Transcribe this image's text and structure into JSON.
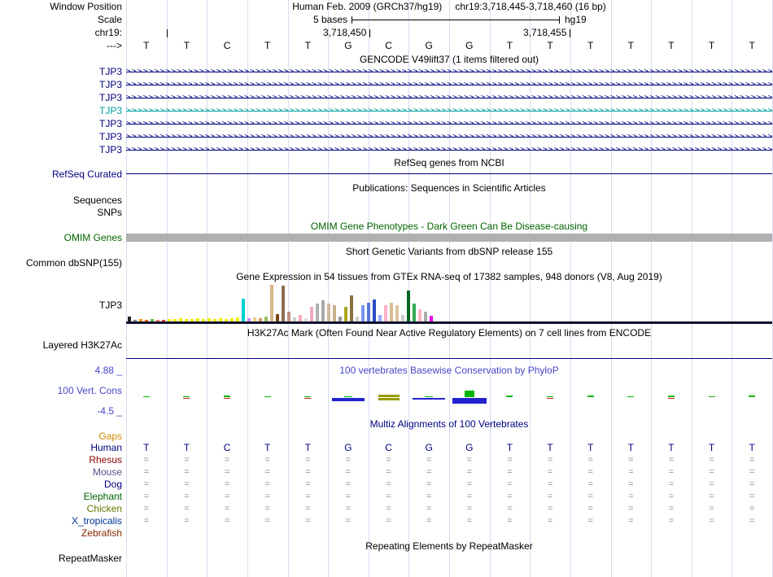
{
  "colors": {
    "gridline": "#d8ddf1",
    "navy": "#000080",
    "teal_gene": "#009e9e",
    "dark_green": "#006400",
    "phylop_blue": "#4646c8",
    "gaps_orange": "#cc8800",
    "omim_bar_gray": "#b0b0b0",
    "cons_green": "#00b400",
    "cons_blue": "#2323cd",
    "cons_red": "#c82323",
    "cons_olive": "#9a9a00"
  },
  "header": {
    "window_position_label": "Window Position",
    "assembly_line": "Human Feb. 2009 (GRCh37/hg19)",
    "range_line": "chr19:3,718,445-3,718,460 (16 bp)",
    "scale_label": "Scale",
    "scale_value": "5 bases",
    "assembly_short": "hg19",
    "chrom_label": "chr19:",
    "tick_label_1": "3,718,450",
    "tick_label_2": "3,718,455",
    "strand_label": "--->",
    "bases": [
      "T",
      "T",
      "C",
      "T",
      "T",
      "G",
      "C",
      "G",
      "G",
      "T",
      "T",
      "T",
      "T",
      "T",
      "T",
      "T"
    ]
  },
  "gencode": {
    "title": "GENCODE V49lift37 (1 items filtered out)",
    "genes": [
      {
        "name": "TJP3",
        "color": "#000080"
      },
      {
        "name": "TJP3",
        "color": "#000080"
      },
      {
        "name": "TJP3",
        "color": "#000080"
      },
      {
        "name": "TJP3",
        "color": "#009e9e"
      },
      {
        "name": "TJP3",
        "color": "#000080"
      },
      {
        "name": "TJP3",
        "color": "#000080"
      },
      {
        "name": "TJP3",
        "color": "#000080"
      }
    ]
  },
  "refseq": {
    "title": "RefSeq genes from NCBI",
    "label": "RefSeq Curated"
  },
  "publications": {
    "title": "Publications: Sequences in Scientific Articles",
    "sequences_label": "Sequences",
    "snps_label": "SNPs"
  },
  "omim": {
    "title": "OMIM Gene Phenotypes - Dark Green Can Be Disease-causing",
    "label": "OMIM Genes"
  },
  "dbsnp": {
    "title": "Short Genetic Variants from dbSNP release 155",
    "label": "Common dbSNP(155)"
  },
  "gtex": {
    "title": "Gene Expression in 54 tissues from GTEx RNA-seq of 17382 samples, 948 donors (V8, Aug 2019)",
    "label": "TJP3",
    "bars": [
      {
        "h": 6,
        "c": "#222222"
      },
      {
        "h": 2,
        "c": "#888888"
      },
      {
        "h": 3,
        "c": "#ff9912"
      },
      {
        "h": 2,
        "c": "#ee6600"
      },
      {
        "h": 3,
        "c": "#66bb44"
      },
      {
        "h": 2,
        "c": "#ff7777"
      },
      {
        "h": 2,
        "c": "#ee3333"
      },
      {
        "h": 3,
        "c": "#eeee00"
      },
      {
        "h": 3,
        "c": "#eeee00"
      },
      {
        "h": 4,
        "c": "#eeee00"
      },
      {
        "h": 3,
        "c": "#eeee00"
      },
      {
        "h": 3,
        "c": "#eeee00"
      },
      {
        "h": 4,
        "c": "#eeee00"
      },
      {
        "h": 3,
        "c": "#eeee00"
      },
      {
        "h": 4,
        "c": "#eeee00"
      },
      {
        "h": 3,
        "c": "#eeee00"
      },
      {
        "h": 4,
        "c": "#eeee00"
      },
      {
        "h": 3,
        "c": "#eeee00"
      },
      {
        "h": 4,
        "c": "#eeee00"
      },
      {
        "h": 5,
        "c": "#eeee00"
      },
      {
        "h": 28,
        "c": "#00d0d0"
      },
      {
        "h": 4,
        "c": "#cc88ff"
      },
      {
        "h": 5,
        "c": "#eecc88"
      },
      {
        "h": 4,
        "c": "#cc9966"
      },
      {
        "h": 6,
        "c": "#99bb55"
      },
      {
        "h": 45,
        "c": "#d6b588"
      },
      {
        "h": 9,
        "c": "#774411"
      },
      {
        "h": 44,
        "c": "#8a6f50"
      },
      {
        "h": 12,
        "c": "#c09080"
      },
      {
        "h": 5,
        "c": "#cccccc"
      },
      {
        "h": 8,
        "c": "#ffaabb"
      },
      {
        "h": 4,
        "c": "#dddddd"
      },
      {
        "h": 18,
        "c": "#eeaabb"
      },
      {
        "h": 22,
        "c": "#b0b0b0"
      },
      {
        "h": 26,
        "c": "#a8a8a8"
      },
      {
        "h": 22,
        "c": "#cdb99a"
      },
      {
        "h": 20,
        "c": "#c7b089"
      },
      {
        "h": 6,
        "c": "#999999"
      },
      {
        "h": 18,
        "c": "#a8a820"
      },
      {
        "h": 32,
        "c": "#8a6f3e"
      },
      {
        "h": 6,
        "c": "#cccccc"
      },
      {
        "h": 20,
        "c": "#7799ee"
      },
      {
        "h": 23,
        "c": "#5577dd"
      },
      {
        "h": 27,
        "c": "#2b4bbf"
      },
      {
        "h": 8,
        "c": "#99aaff"
      },
      {
        "h": 20,
        "c": "#ffb0c8"
      },
      {
        "h": 23,
        "c": "#d8bb90"
      },
      {
        "h": 20,
        "c": "#ddc59e"
      },
      {
        "h": 8,
        "c": "#cccccc"
      },
      {
        "h": 38,
        "c": "#006622"
      },
      {
        "h": 22,
        "c": "#33aa55"
      },
      {
        "h": 15,
        "c": "#ffb6c1"
      },
      {
        "h": 12,
        "c": "#aaaaaa"
      },
      {
        "h": 7,
        "c": "#ee00ee"
      }
    ]
  },
  "h3k27ac": {
    "title": "H3K27Ac Mark (Often Found Near Active Regulatory Elements) on 7 cell lines from ENCODE",
    "label": "Layered H3K27Ac"
  },
  "conservation": {
    "title": "100 vertebrates Basewise Conservation by PhyloP",
    "label": "100 Vert. Cons",
    "max": "4.88 _",
    "min": "-4.5 _",
    "marks": [
      {
        "p": 1
      },
      {
        "p": 1,
        "n": 1,
        "nc": "red"
      },
      {
        "p": 2,
        "n": 1,
        "nc": "red"
      },
      {
        "p": 1
      },
      {
        "p": 1,
        "n": 1,
        "nc": "red"
      },
      {
        "p": 1,
        "n": 4,
        "w": 10,
        "nw": 40,
        "nc": "blue"
      },
      {
        "p": 3,
        "n": 3,
        "w": 26,
        "nw": 26,
        "pc": "olive",
        "nc": "olive"
      },
      {
        "p": 1,
        "n": 2,
        "w": 10,
        "nw": 40,
        "nc": "blue"
      },
      {
        "p": 8,
        "n": 7,
        "w": 12,
        "nw": 42,
        "nc": "blue"
      },
      {
        "p": 2
      },
      {
        "p": 1,
        "n": 1,
        "nc": "red"
      },
      {
        "p": 2
      },
      {
        "p": 1
      },
      {
        "p": 2,
        "n": 1,
        "nc": "red"
      },
      {
        "p": 1
      },
      {
        "p": 2
      }
    ]
  },
  "multiz": {
    "title": "Multiz Alignments of 100 Vertebrates",
    "gaps_label": "Gaps",
    "species": [
      {
        "name": "Human",
        "color": "#000080",
        "type": "bases"
      },
      {
        "name": "Rhesus",
        "color": "#8b0000",
        "type": "eq"
      },
      {
        "name": "Mouse",
        "color": "#54548c",
        "type": "eq"
      },
      {
        "name": "Dog",
        "color": "#000080",
        "type": "eq"
      },
      {
        "name": "Elephant",
        "color": "#006400",
        "type": "eq"
      },
      {
        "name": "Chicken",
        "color": "#667700",
        "type": "eq"
      },
      {
        "name": "X_tropicalis",
        "color": "#003399",
        "type": "eq"
      },
      {
        "name": "Zebrafish",
        "color": "#8b2500",
        "type": "none"
      }
    ]
  },
  "repeatmasker": {
    "title": "Repeating Elements by RepeatMasker",
    "label": "RepeatMasker"
  }
}
